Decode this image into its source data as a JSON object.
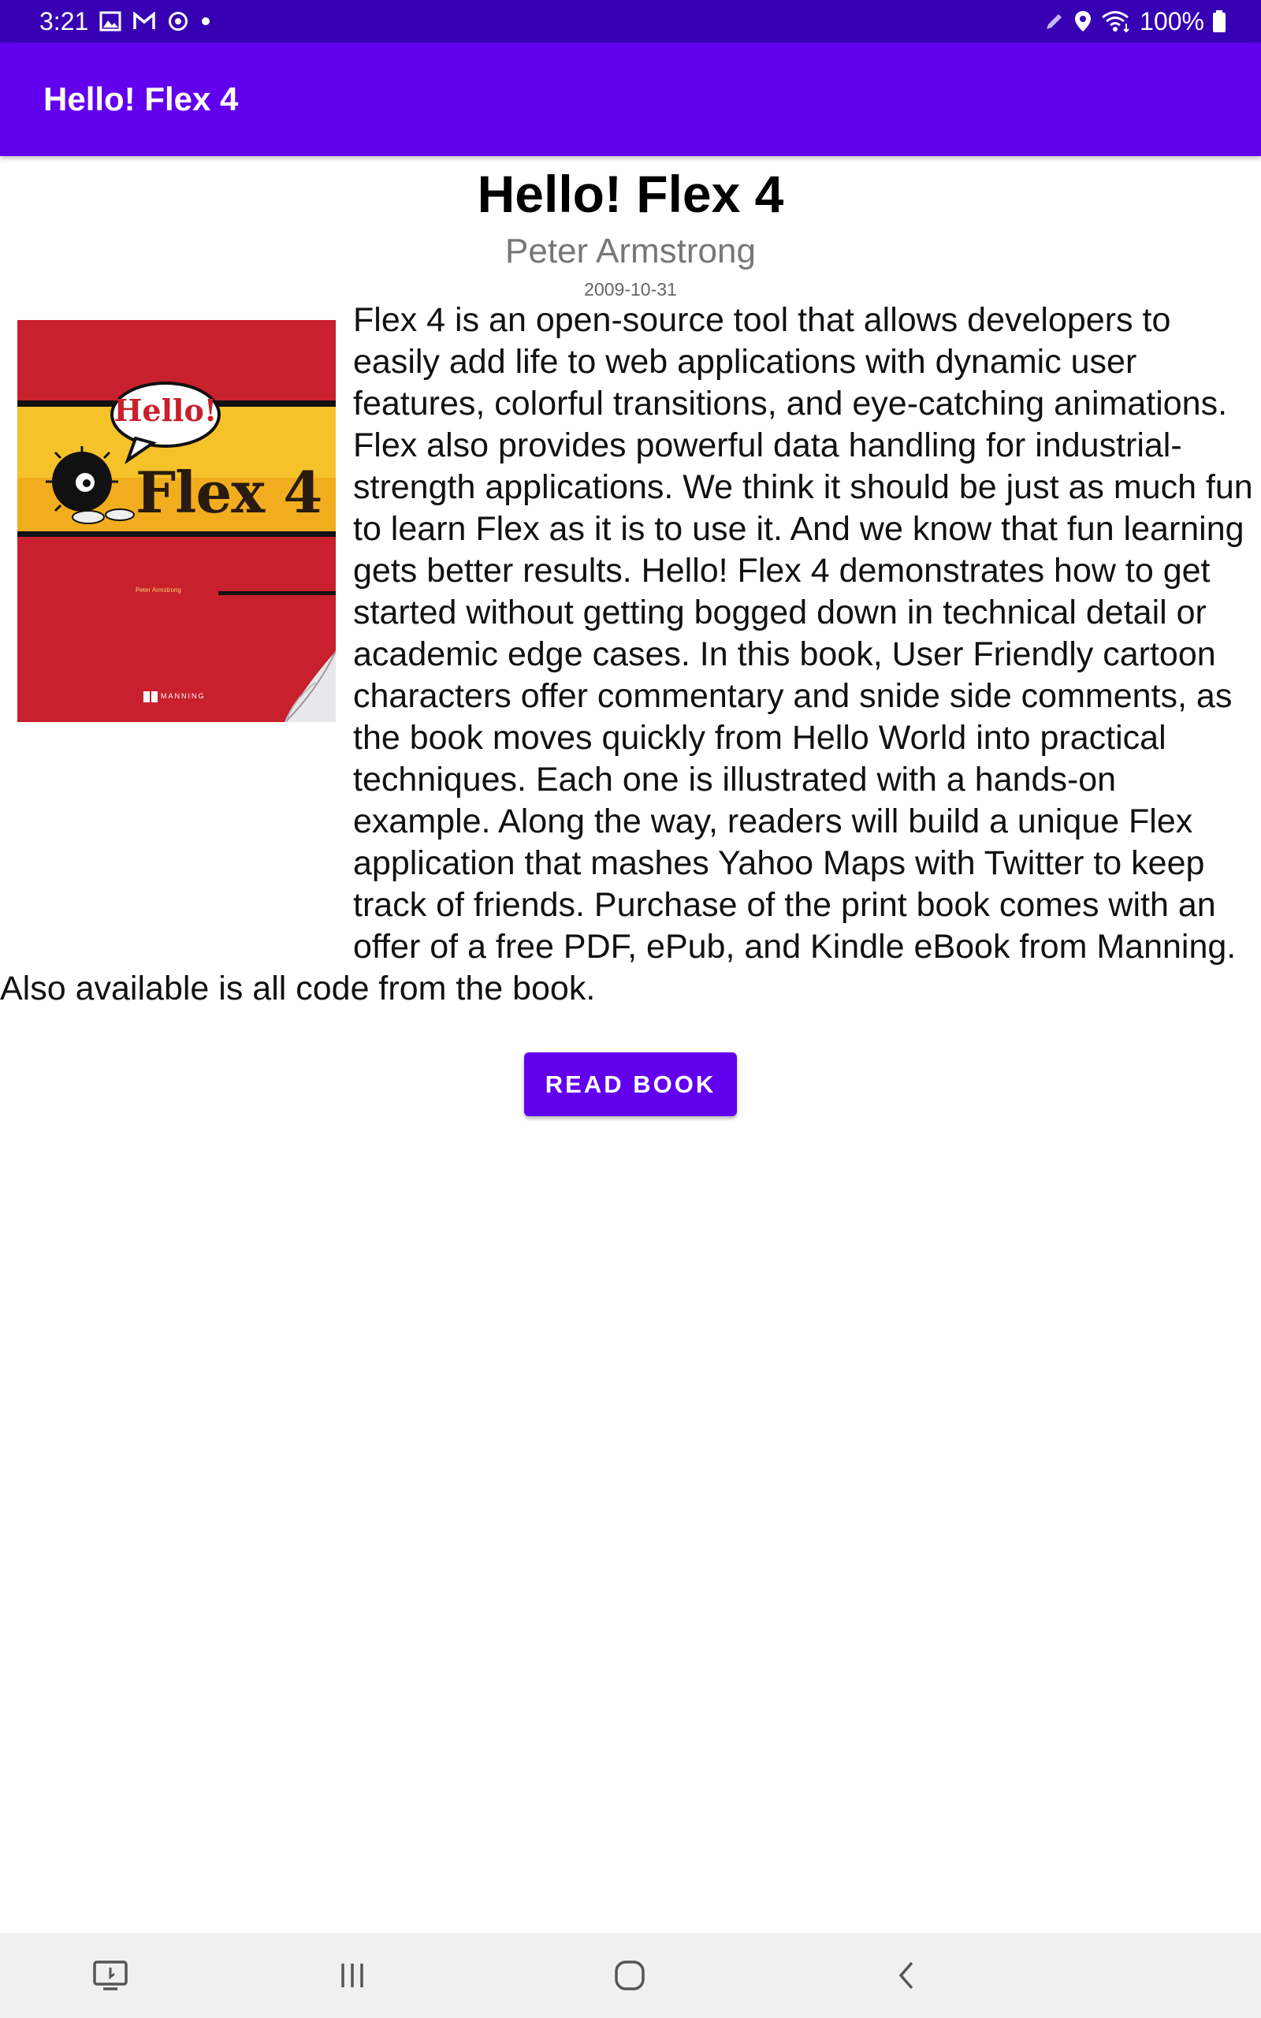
{
  "status_bar": {
    "time": "3:21",
    "left_icons": [
      "gallery-icon",
      "gmail-icon",
      "sync-icon",
      "dot-icon"
    ],
    "right_icons": [
      "pen-icon",
      "location-icon",
      "wifi-icon"
    ],
    "battery": "100%"
  },
  "app_bar": {
    "title": "Hello! Flex 4"
  },
  "book": {
    "title": "Hello! Flex 4",
    "author": "Peter Armstrong",
    "date": "2009-10-31",
    "cover": {
      "hello_text": "Hello!",
      "flex_text": "Flex 4",
      "author_small": "Peter Armstrong",
      "publisher": "MANNING"
    },
    "description": "Flex 4 is an open-source tool that allows developers to easily add life to web applications with dynamic user features, colorful transitions, and eye-catching animations. Flex also provides powerful data handling for industrial-strength applications. We think it should be just as much fun to learn Flex as it is to use it. And we know that fun learning gets better results. Hello! Flex 4 demonstrates how to get started without getting bogged down in technical detail or academic edge cases. In this book, User Friendly cartoon characters offer commentary and snide side comments, as the book moves quickly from Hello World into practical techniques. Each one is illustrated with a hands-on example. Along the way, readers will build a unique Flex application that mashes Yahoo Maps with Twitter to keep track of friends. Purchase of the print book comes with an offer of a free PDF, ePub, and Kindle eBook from Manning. Also available is all code from the book."
  },
  "read_button": {
    "label": "READ BOOK"
  },
  "nav_bar": {
    "icons": [
      "screen-icon",
      "recents-icon",
      "home-icon",
      "back-icon"
    ]
  },
  "colors": {
    "status_bar": "#3700b3",
    "app_bar": "#6200ee",
    "button": "#6200ee",
    "cover_red": "#c8202c",
    "cover_yellow": "#f6c22a"
  }
}
